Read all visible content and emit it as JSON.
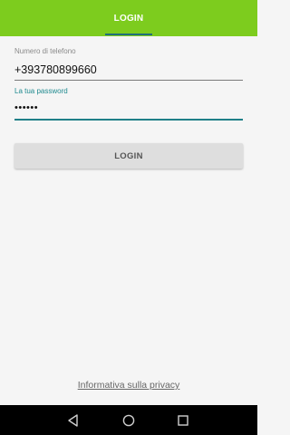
{
  "appbar": {
    "tab_label": "LOGIN",
    "background_color": "#7dcc1e",
    "indicator_color": "#1f6f7a"
  },
  "form": {
    "phone": {
      "label": "Numero di telefono",
      "value": "+393780899660"
    },
    "password": {
      "label": "La tua password",
      "value": "••••••"
    },
    "login_button_label": "LOGIN"
  },
  "footer": {
    "privacy_link": "Informativa sulla privacy"
  },
  "navbar": {
    "icons": [
      "back-icon",
      "home-icon",
      "recents-icon"
    ]
  }
}
